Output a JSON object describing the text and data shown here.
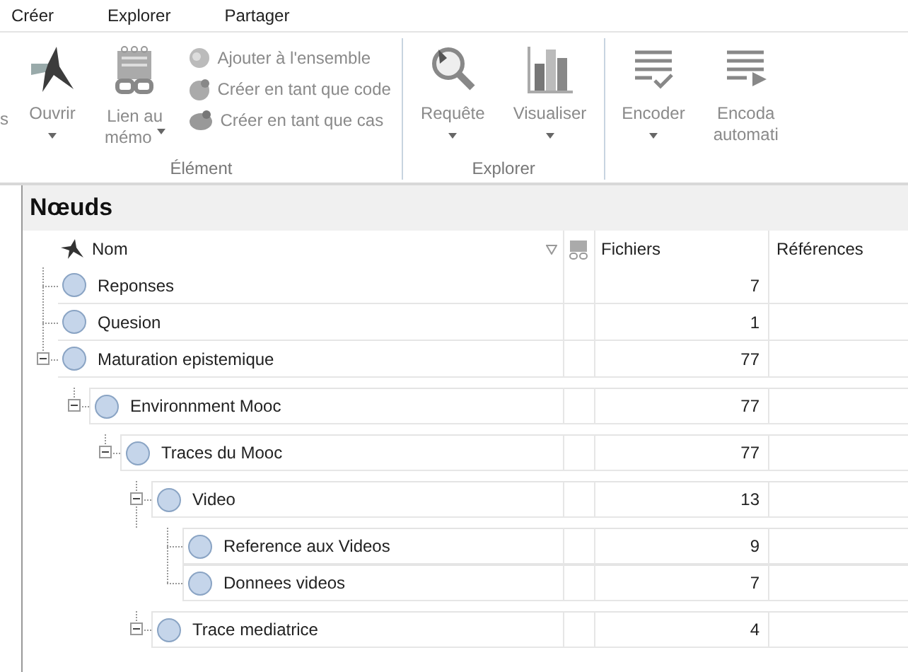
{
  "menu": [
    {
      "label": "Créer"
    },
    {
      "label": "Explorer"
    },
    {
      "label": "Partager"
    }
  ],
  "ribbon": {
    "groups": [
      {
        "label": "Élément",
        "items": [
          {
            "kind": "cut",
            "lines": [
              "s"
            ]
          },
          {
            "kind": "large",
            "lines": [
              "Ouvrir"
            ],
            "dropdown": true
          },
          {
            "kind": "large",
            "lines": [
              "Lien au",
              "mémo"
            ],
            "dropdown": true
          },
          {
            "kind": "stack",
            "entries": [
              "Ajouter à l'ensemble",
              "Créer en tant que code",
              "Créer en tant que cas"
            ]
          }
        ]
      },
      {
        "label": "Explorer",
        "items": [
          {
            "kind": "large",
            "lines": [
              "Requête"
            ],
            "dropdown": true
          },
          {
            "kind": "large",
            "lines": [
              "Visualiser"
            ],
            "dropdown": true
          }
        ]
      },
      {
        "items": [
          {
            "kind": "large",
            "lines": [
              "Encoder"
            ],
            "dropdown": true
          },
          {
            "kind": "large",
            "lines": [
              "Encoda",
              "automati"
            ],
            "dropdown": false
          }
        ]
      }
    ]
  },
  "panel": {
    "title": "Nœuds",
    "columns": [
      {
        "label": "Nom"
      },
      {
        "label": "Fichiers"
      },
      {
        "label": "Références"
      }
    ],
    "nodes": [
      {
        "name": "Reponses",
        "files": "7"
      },
      {
        "name": "Quesion",
        "files": "1"
      },
      {
        "name": "Maturation epistemique",
        "files": "77",
        "expanded": true,
        "children": [
          {
            "name": "Environnment Mooc",
            "files": "77",
            "expanded": true,
            "children": [
              {
                "name": "Traces du Mooc",
                "files": "77",
                "expanded": true,
                "children": [
                  {
                    "name": "Video",
                    "files": "13",
                    "expanded": true,
                    "children": [
                      {
                        "name": "Reference aux Videos",
                        "files": "9"
                      },
                      {
                        "name": "Donnees videos",
                        "files": "7"
                      }
                    ]
                  },
                  {
                    "name": "Trace mediatrice",
                    "files": "4",
                    "expanded": true
                  }
                ]
              }
            ]
          }
        ]
      }
    ]
  }
}
